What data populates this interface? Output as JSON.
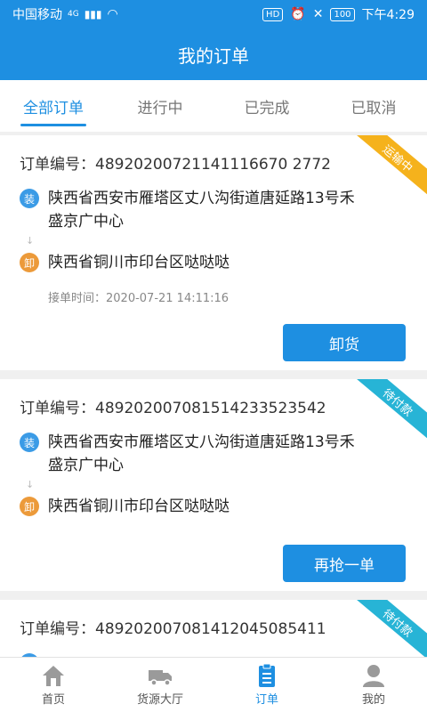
{
  "statusbar": {
    "carrier": "中国移动",
    "network": "4G",
    "battery": "100",
    "time": "下午4:29"
  },
  "header": {
    "title": "我的订单"
  },
  "tabs": [
    {
      "label": "全部订单",
      "active": true
    },
    {
      "label": "进行中",
      "active": false
    },
    {
      "label": "已完成",
      "active": false
    },
    {
      "label": "已取消",
      "active": false
    }
  ],
  "orders": [
    {
      "order_no": "订单编号：48920200721141116670 2772",
      "load_badge": "装",
      "load_address": "陕西省西安市雁塔区丈八沟街道唐延路13号禾盛京广中心",
      "unload_badge": "卸",
      "unload_address": "陕西省铜川市印台区哒哒哒",
      "accept_time": "接单时间：2020-07-21 14:11:16",
      "button": "卸货",
      "status": "运输中",
      "status_color": "#f5b21c"
    },
    {
      "order_no": "订单编号：489202007081514233523542",
      "load_badge": "装",
      "load_address": "陕西省西安市雁塔区丈八沟街道唐延路13号禾盛京广中心",
      "unload_badge": "卸",
      "unload_address": "陕西省铜川市印台区哒哒哒",
      "button": "再抢一单",
      "status": "待付款",
      "status_color": "#27b4d6"
    },
    {
      "order_no": "订单编号：489202007081412045085411",
      "load_badge": "装",
      "status": "待付款",
      "status_color": "#27b4d6"
    }
  ],
  "nav": [
    {
      "label": "首页",
      "icon": "home-icon",
      "active": false
    },
    {
      "label": "货源大厅",
      "icon": "truck-icon",
      "active": false
    },
    {
      "label": "订单",
      "icon": "clipboard-icon",
      "active": true
    },
    {
      "label": "我的",
      "icon": "user-icon",
      "active": false
    }
  ],
  "colors": {
    "primary": "#1e8fe1",
    "load": "#3b9be6",
    "unload": "#ec9a3a"
  }
}
